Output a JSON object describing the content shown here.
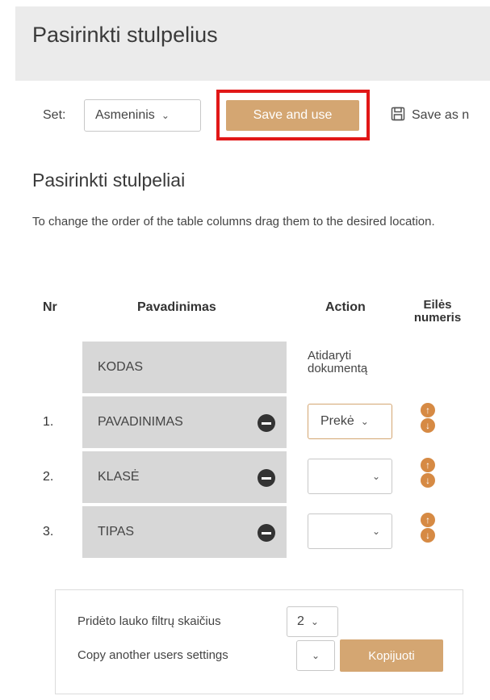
{
  "header": {
    "title": "Pasirinkti stulpelius"
  },
  "toolbar": {
    "set_label": "Set:",
    "set_value": "Asmeninis",
    "save_use_label": "Save and use",
    "save_as_label": "Save as n"
  },
  "section": {
    "title": "Pasirinkti stulpeliai",
    "description": "To change the order of the table columns drag them to the desired location."
  },
  "table": {
    "headers": {
      "nr": "Nr",
      "name": "Pavadinimas",
      "action": "Action",
      "order": "Eilės numeris"
    },
    "rows": [
      {
        "nr": "",
        "name": "KODAS",
        "action_text": "Atidaryti dokumentą",
        "select": ""
      },
      {
        "nr": "1.",
        "name": "PAVADINIMAS",
        "select": "Prekė"
      },
      {
        "nr": "2.",
        "name": "KLASĖ",
        "select": ""
      },
      {
        "nr": "3.",
        "name": "TIPAS",
        "select": ""
      }
    ]
  },
  "panel": {
    "filters_label": "Pridėto lauko filtrų skaičius",
    "filters_value": "2",
    "copy_label": "Copy another users settings",
    "copy_value": "",
    "copy_button": "Kopijuoti"
  },
  "colors": {
    "accent": "#d4a672",
    "highlight": "#e11717",
    "arrow": "#d68a44"
  },
  "icons": [
    "save-icon",
    "chevron-down-icon",
    "minus-circle-icon",
    "arrow-up-icon",
    "arrow-down-icon"
  ]
}
